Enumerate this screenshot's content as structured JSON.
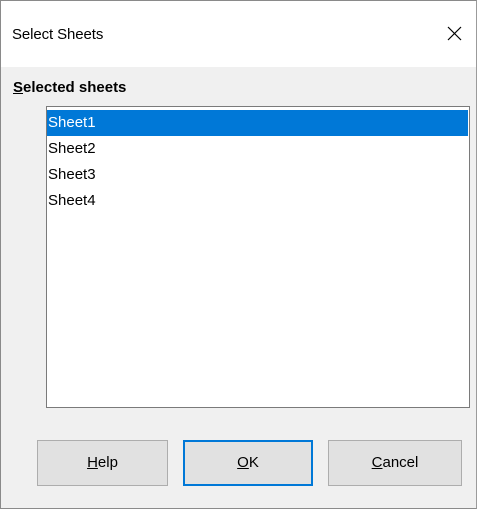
{
  "window": {
    "title": "Select Sheets",
    "close_icon": "close-x-icon"
  },
  "section": {
    "label_mnemonic": "S",
    "label_rest": "elected sheets"
  },
  "sheets": {
    "items": [
      {
        "label": "Sheet1",
        "selected": true
      },
      {
        "label": "Sheet2",
        "selected": false
      },
      {
        "label": "Sheet3",
        "selected": false
      },
      {
        "label": "Sheet4",
        "selected": false
      }
    ]
  },
  "buttons": {
    "help": {
      "mnemonic": "H",
      "rest": "elp"
    },
    "ok": {
      "mnemonic": "O",
      "rest": "K"
    },
    "cancel": {
      "mnemonic": "C",
      "rest": "ancel"
    }
  },
  "colors": {
    "selection": "#0078d7",
    "dialog_bg": "#f0f0f0",
    "button_bg": "#e1e1e1",
    "default_button_border": "#0078d7"
  }
}
